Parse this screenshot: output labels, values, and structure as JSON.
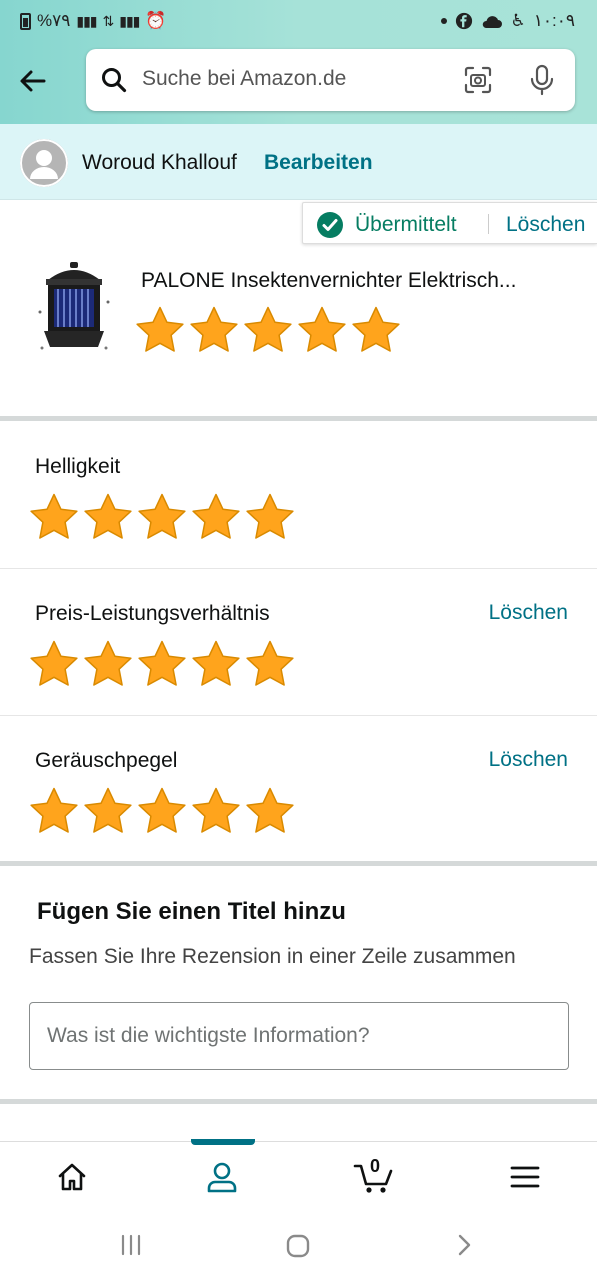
{
  "status_bar": {
    "left_text": "%٧٩",
    "right_time": "١٠:٠٩"
  },
  "search": {
    "placeholder": "Suche bei Amazon.de"
  },
  "user": {
    "name": "Woroud Khallouf",
    "edit_label": "Bearbeiten"
  },
  "submission": {
    "status_label": "Übermittelt",
    "delete_label": "Löschen"
  },
  "product": {
    "name": "PALONE Insektenvernichter Elektrisch...",
    "rating": 5,
    "max_rating": 5
  },
  "attribute_ratings": [
    {
      "label": "Helligkeit",
      "rating": 5,
      "delete_label": ""
    },
    {
      "label": "Preis-Leistungsverhältnis",
      "rating": 5,
      "delete_label": "Löschen"
    },
    {
      "label": "Geräuschpegel",
      "rating": 5,
      "delete_label": "Löschen"
    }
  ],
  "title_section": {
    "heading": "Fügen Sie einen Titel hinzu",
    "subheading": "Fassen Sie Ihre Rezension in einer Zeile zusammen",
    "input_placeholder": "Was ist die wichtigste Information?",
    "input_value": ""
  },
  "bottom_nav": {
    "cart_count": "0",
    "items": [
      "home-icon",
      "account-icon",
      "cart-icon",
      "menu-icon"
    ],
    "active": "account-icon"
  },
  "colors": {
    "link": "#007185",
    "success": "#067d62",
    "star": "#ffa41c",
    "header_gradient": "#86d6cf",
    "user_bar": "#dcf5f7"
  }
}
